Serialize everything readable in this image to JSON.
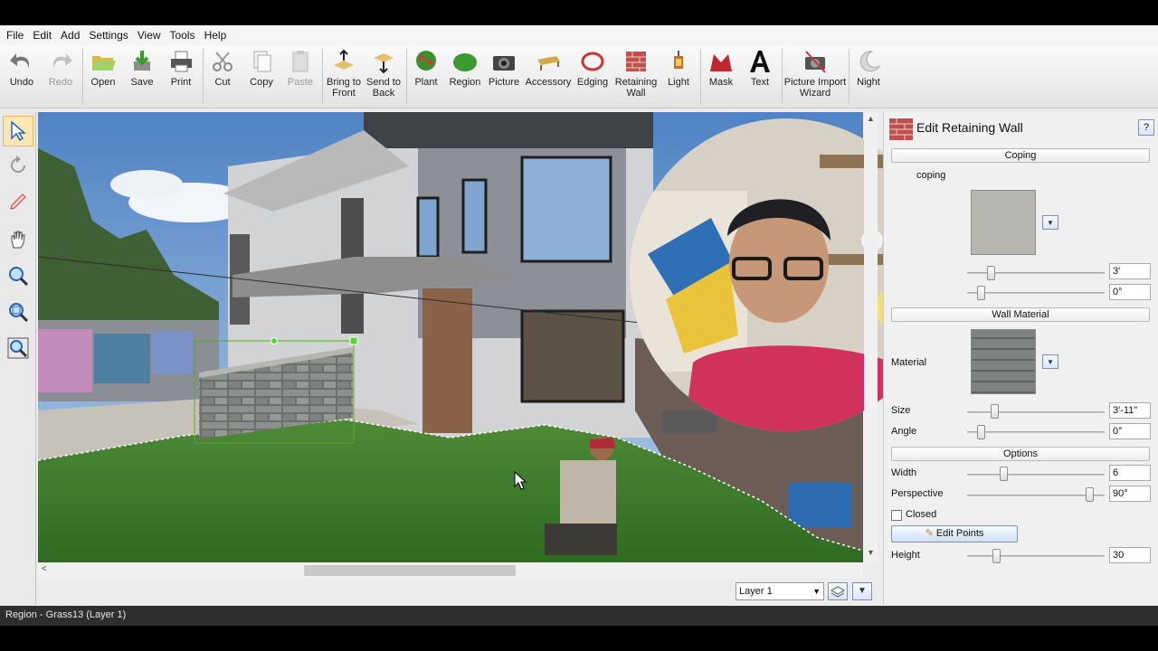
{
  "menu": [
    "File",
    "Edit",
    "Add",
    "Settings",
    "View",
    "Tools",
    "Help"
  ],
  "toolbar": {
    "undo": "Undo",
    "redo": "Redo",
    "open": "Open",
    "save": "Save",
    "print": "Print",
    "cut": "Cut",
    "copy": "Copy",
    "paste": "Paste",
    "bring_front_1": "Bring to",
    "bring_front_2": "Front",
    "send_back_1": "Send to",
    "send_back_2": "Back",
    "plant": "Plant",
    "region": "Region",
    "picture": "Picture",
    "accessory": "Accessory",
    "edging": "Edging",
    "retaining_1": "Retaining",
    "retaining_2": "Wall",
    "light": "Light",
    "mask": "Mask",
    "text": "Text",
    "pic_import_1": "Picture Import",
    "pic_import_2": "Wizard",
    "night": "Night"
  },
  "panel": {
    "title": "Edit Retaining Wall",
    "help": "?",
    "coping_header": "Coping",
    "coping_label": "coping",
    "coping_value1": "3'",
    "coping_value2": "0°",
    "wall_material_header": "Wall Material",
    "material_label": "Material",
    "size_label": "Size",
    "size_value": "3'-11\"",
    "angle_label": "Angle",
    "angle_value": "0°",
    "options_header": "Options",
    "width_label": "Width",
    "width_value": "6",
    "perspective_label": "Perspective",
    "perspective_value": "90°",
    "closed_label": "Closed",
    "edit_points": "Edit Points",
    "height_label": "Height",
    "height_value": "30"
  },
  "layer_select": "Layer 1",
  "status": "Region - Grass13 (Layer 1)",
  "colors": {
    "grass": "#3f7a2e",
    "sky": "#7aa7d6",
    "selection": "#5aa832"
  },
  "scroll": {
    "horizontal_position": 0.43
  }
}
